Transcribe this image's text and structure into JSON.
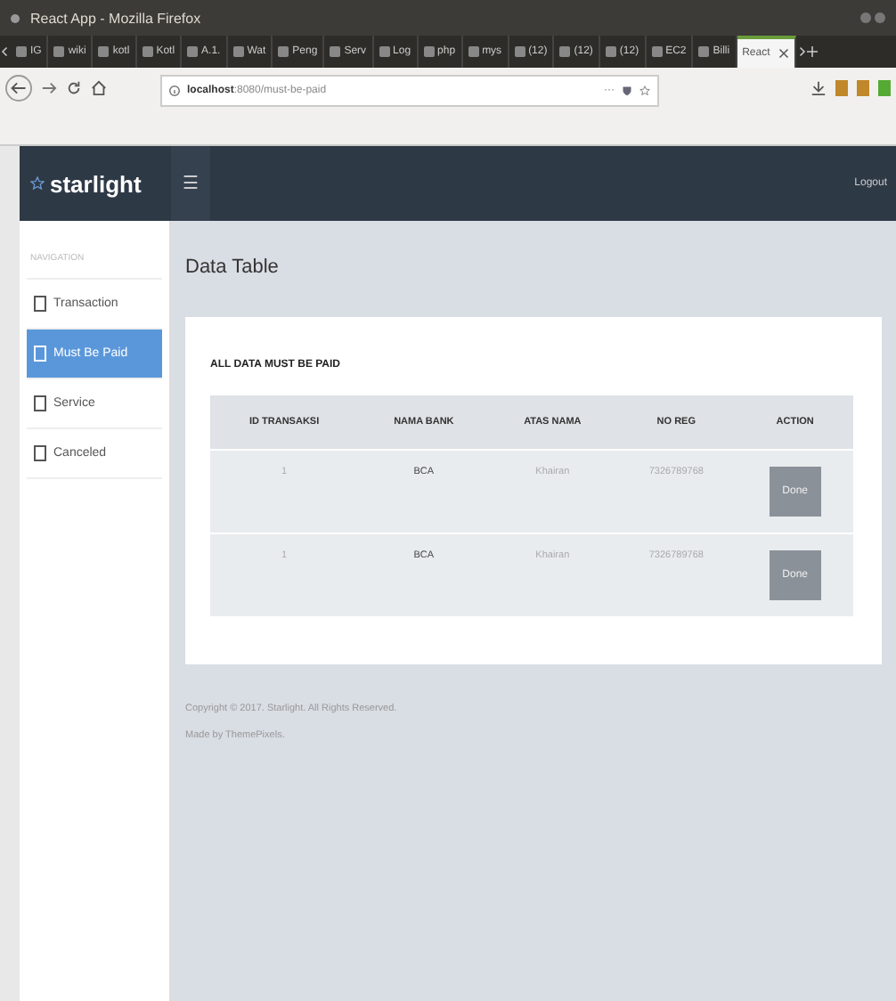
{
  "window": {
    "title": "React App - Mozilla Firefox"
  },
  "browser_tabs": [
    {
      "label": "IG",
      "selected": false
    },
    {
      "label": "wiki",
      "selected": false
    },
    {
      "label": "kotl",
      "selected": false
    },
    {
      "label": "Kotl",
      "selected": false
    },
    {
      "label": "A.1.",
      "selected": false
    },
    {
      "label": "Wat",
      "selected": false
    },
    {
      "label": "Peng",
      "selected": false
    },
    {
      "label": "Serv",
      "selected": false
    },
    {
      "label": "Log",
      "selected": false
    },
    {
      "label": "php",
      "selected": false
    },
    {
      "label": "mys",
      "selected": false
    },
    {
      "label": "(12)",
      "selected": false
    },
    {
      "label": "(12)",
      "selected": false
    },
    {
      "label": "(12)",
      "selected": false
    },
    {
      "label": "EC2",
      "selected": false
    },
    {
      "label": "Billi",
      "selected": false
    },
    {
      "label": "React",
      "selected": true
    }
  ],
  "address_bar": {
    "host": "localhost",
    "rest": ":8080/must-be-paid",
    "more": "···"
  },
  "app": {
    "brand": "starlight",
    "menu_glyph": "☰",
    "logout": "Logout"
  },
  "sidebar": {
    "heading": "NAVIGATION",
    "items": [
      {
        "label": "Transaction",
        "selected": false
      },
      {
        "label": "Must Be Paid",
        "selected": true
      },
      {
        "label": "Service",
        "selected": false
      },
      {
        "label": "Canceled",
        "selected": false
      }
    ]
  },
  "page_title": "Data Table",
  "card": {
    "title": "ALL DATA MUST BE PAID",
    "table": {
      "columns": [
        "ID TRANSAKSI",
        "NAMA BANK",
        "ATAS NAMA",
        "NO REG",
        "ACTION"
      ],
      "rows": [
        {
          "id": "1",
          "bank": "BCA",
          "name": "Khairan",
          "reg": "7326789768",
          "action": "Done"
        },
        {
          "id": "1",
          "bank": "BCA",
          "name": "Khairan",
          "reg": "7326789768",
          "action": "Done"
        }
      ]
    }
  },
  "footer": [
    "Copyright © 2017. Starlight. All Rights Reserved.",
    "Made by ThemePixels."
  ]
}
